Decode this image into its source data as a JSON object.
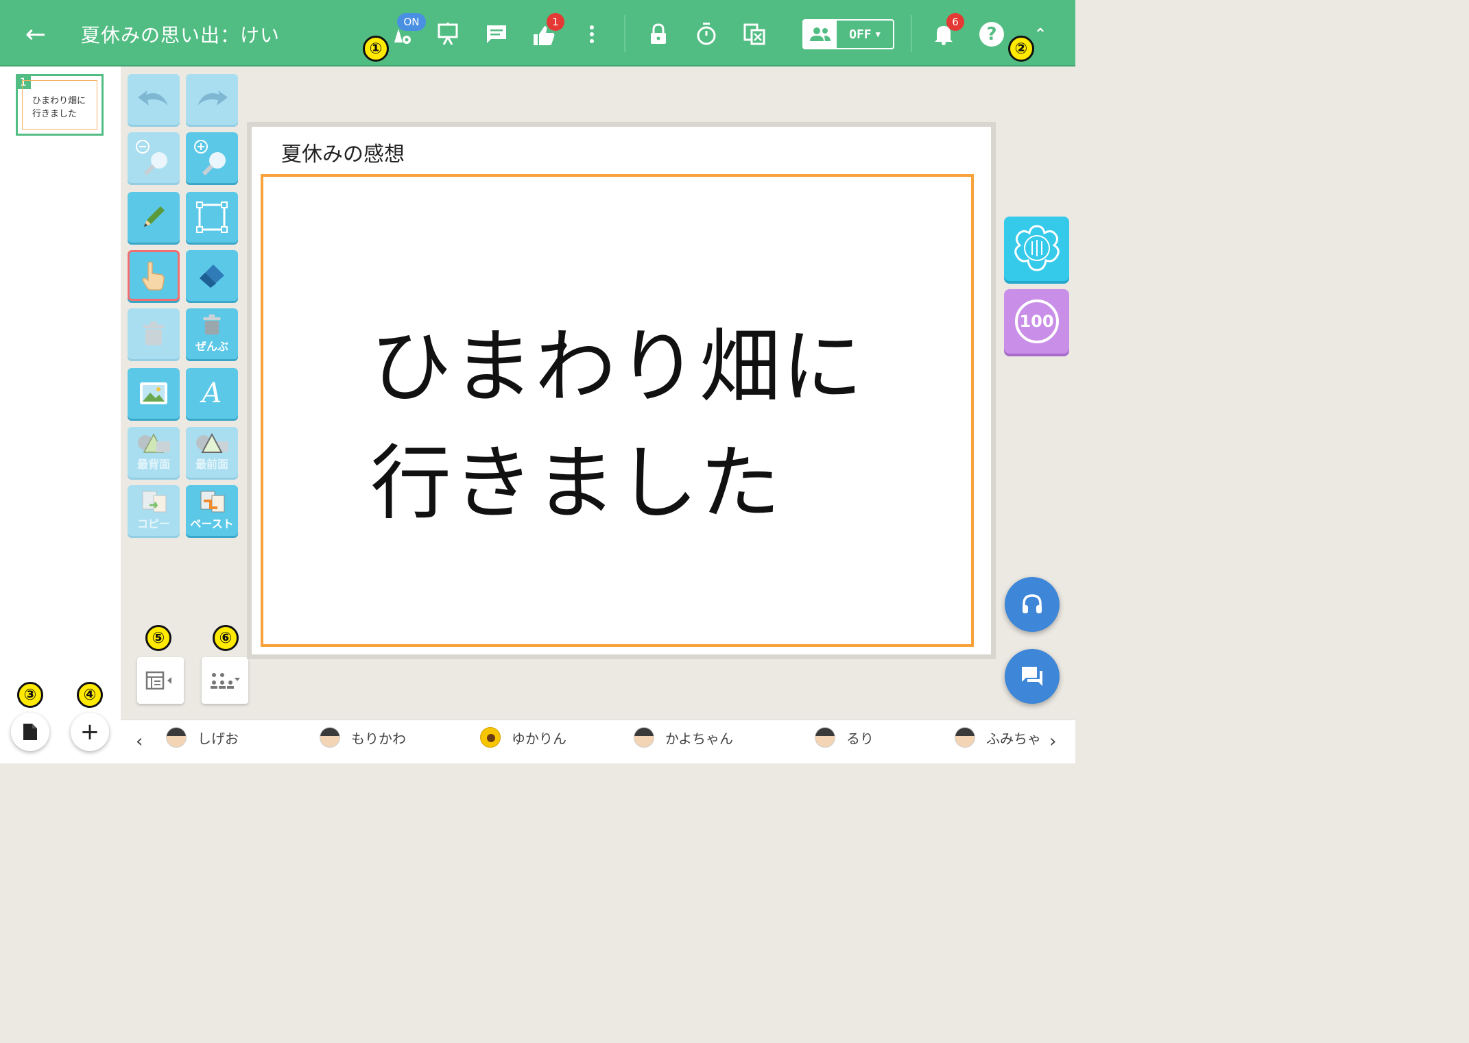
{
  "header": {
    "back_label": "←",
    "title": "夏休みの思い出：けい",
    "ai_on_badge": "ON",
    "like_badge_count": "1",
    "group_select_value": "OFF",
    "notification_count": "6",
    "help_label": "?",
    "collapse_label": "⌃"
  },
  "markers": [
    "①",
    "②",
    "③",
    "④",
    "⑤",
    "⑥"
  ],
  "sidebar": {
    "pages": [
      {
        "number": "1",
        "line1": "ひまわり畑に",
        "line2": "行きました"
      }
    ],
    "add_label": "+"
  },
  "tools": {
    "delete_all_label": "ぜんぶ",
    "text_label": "A",
    "send_back_label": "最背面",
    "bring_front_label": "最前面",
    "copy_label": "コピー",
    "paste_label": "ペースト"
  },
  "canvas": {
    "title": "夏休みの感想",
    "line1": "ひまわり畑に",
    "line2": "行きました"
  },
  "side_cards": {
    "score_label": "100"
  },
  "students": [
    {
      "name": "しげお",
      "avatar": "boy"
    },
    {
      "name": "もりかわ",
      "avatar": "boy"
    },
    {
      "name": "ゆかりん",
      "avatar": "sunflower"
    },
    {
      "name": "かよちゃん",
      "avatar": "boy"
    },
    {
      "name": "るり",
      "avatar": "boy"
    },
    {
      "name": "ふみちゃ",
      "avatar": "boy"
    }
  ],
  "nav": {
    "prev": "‹",
    "next": "›"
  },
  "colors": {
    "header": "#52bd83",
    "tool": "#5bc8e8",
    "highlight": "#f7a23b",
    "fab": "#3d86d8",
    "badge": "#e53935"
  }
}
